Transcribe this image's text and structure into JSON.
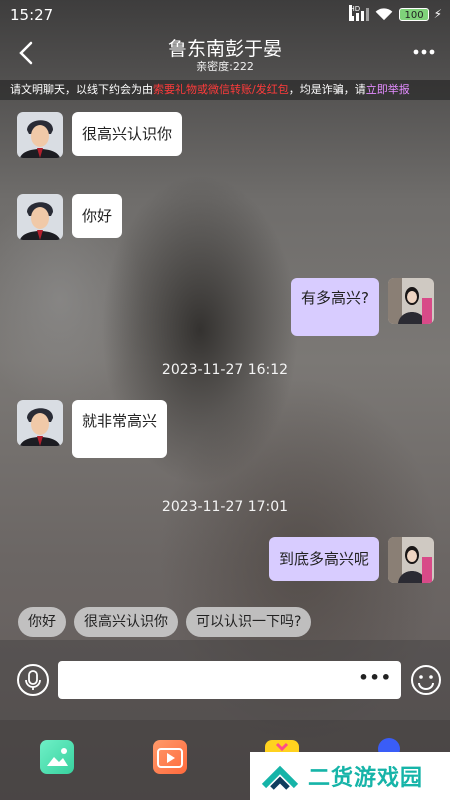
{
  "status_bar": {
    "time": "15:27",
    "network": "HD",
    "battery": "100"
  },
  "header": {
    "title": "鲁东南彭于晏",
    "subtitle": "亲密度:222",
    "more_label": "•••"
  },
  "notice": {
    "part1": "请文明聊天，以线下约会为由",
    "part2": "索要礼物或微信转账/发红包",
    "part3": "，均是诈骗，请",
    "part4": "立即举报",
    "highlight_color": "#ff3b3b",
    "link_color": "#e38cff"
  },
  "messages": [
    {
      "side": "left",
      "text": "很高兴认识你"
    },
    {
      "side": "left",
      "text": "你好"
    },
    {
      "side": "right",
      "text": "有多高兴?"
    },
    {
      "side": "left",
      "text": "就非常高兴"
    },
    {
      "side": "right",
      "text": "到底多高兴呢"
    }
  ],
  "timestamps": [
    "2023-11-27 16:12",
    "2023-11-27 17:01"
  ],
  "quick_replies": [
    "你好",
    "很高兴认识你",
    "可以认识一下吗?"
  ],
  "input": {
    "value": "",
    "more_label": "•••"
  },
  "toolbar": {
    "icons": [
      "image-icon",
      "video-icon",
      "gift-icon",
      "extra-icon"
    ]
  },
  "watermark": {
    "text": "二货游戏园"
  },
  "colors": {
    "bubble_right": "#d8ccff",
    "bubble_left": "#ffffff",
    "chip_bg": "#cdcdcd",
    "watermark": "#16b4a8"
  }
}
